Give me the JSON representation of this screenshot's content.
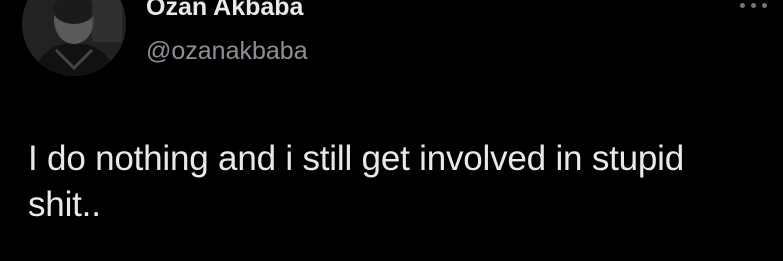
{
  "tweet": {
    "author": {
      "display_name": "Ozan Akbaba",
      "handle": "@ozanakbaba",
      "avatar_icon": "profile-photo"
    },
    "text": "I do nothing and i still get involved in stupid\nshit..",
    "more_icon": "more-horizontal-icon"
  },
  "colors": {
    "background": "#000000",
    "primary_text": "#e7e9ea",
    "secondary_text": "#8b9096",
    "icon": "#71767b"
  }
}
